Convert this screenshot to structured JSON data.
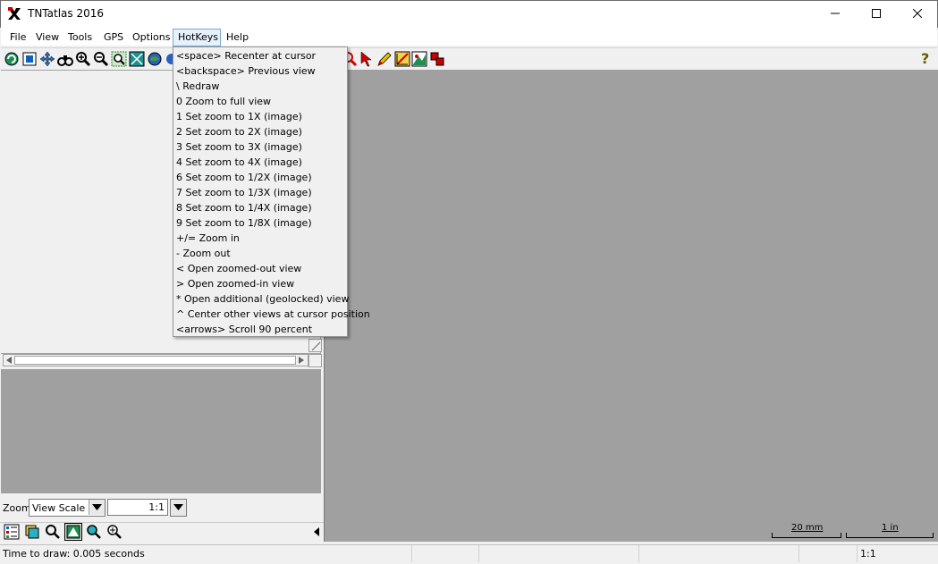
{
  "window": {
    "title": "TNTatlas 2016"
  },
  "menubar": {
    "items": [
      {
        "label": "File"
      },
      {
        "label": "View"
      },
      {
        "label": "Tools"
      },
      {
        "label": "GPS"
      },
      {
        "label": "Options"
      },
      {
        "label": "HotKeys"
      },
      {
        "label": "Help"
      }
    ]
  },
  "hotkeys_menu": {
    "items": [
      "<space> Recenter at cursor",
      "<backspace> Previous view",
      "\\ Redraw",
      "0 Zoom to full view",
      "1 Set zoom to 1X (image)",
      "2 Set zoom to 2X (image)",
      "3 Set zoom to 3X (image)",
      "4 Set zoom to 4X (image)",
      "6 Set zoom to 1/2X (image)",
      "7 Set zoom to 1/3X (image)",
      "8 Set zoom to 1/4X (image)",
      "9 Set zoom to 1/8X (image)",
      "+/= Zoom in",
      "- Zoom out",
      "< Open zoomed-out view",
      "> Open zoomed-in view",
      "* Open additional (geolocked) view",
      "^ Center other views at cursor position",
      "<arrows> Scroll 90 percent"
    ]
  },
  "zoom": {
    "label": "Zoom",
    "mode": "View Scale",
    "value": "1:1"
  },
  "scale": {
    "metric_label": "20 mm",
    "imperial_label": "1 in"
  },
  "status": {
    "message": "Time to draw: 0.005 seconds",
    "scale": "1:1"
  },
  "icons": {
    "help": "question-mark",
    "colors": {
      "map_bg": "#a0a0a0",
      "accent": "#cc0000"
    }
  }
}
